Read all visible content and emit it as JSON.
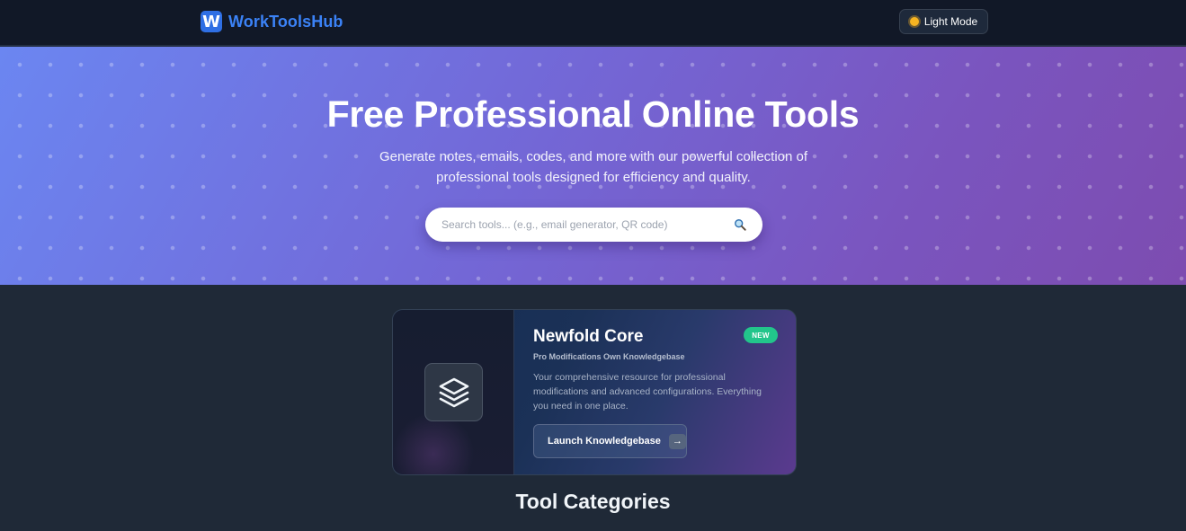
{
  "header": {
    "logo_letter": "W",
    "logo_text": "WorkToolsHub",
    "mode_label": "Light Mode"
  },
  "hero": {
    "title": "Free Professional Online Tools",
    "subtitle": "Generate notes, emails, codes, and more with our powerful collection of professional tools designed for efficiency and quality.",
    "search_placeholder": "Search tools... (e.g., email generator, QR code)"
  },
  "feature": {
    "title": "Newfold Core",
    "badge": "NEW",
    "subtitle": "Pro Modifications Own Knowledgebase",
    "description": "Your comprehensive resource for professional modifications and advanced configurations. Everything you need in one place.",
    "button_label": "Launch Knowledgebase",
    "button_arrow": "→"
  },
  "section": {
    "title": "Tool Categories"
  },
  "colors": {
    "brand": "#3b82f6",
    "badge": "#22c58b",
    "page_bg": "#1f2937",
    "header_bg": "#111827"
  },
  "icons": {
    "logo": "w-logo-icon",
    "mode": "sun-icon",
    "search": "magnifier-icon",
    "feature": "layers-icon",
    "button": "arrow-right-icon"
  }
}
